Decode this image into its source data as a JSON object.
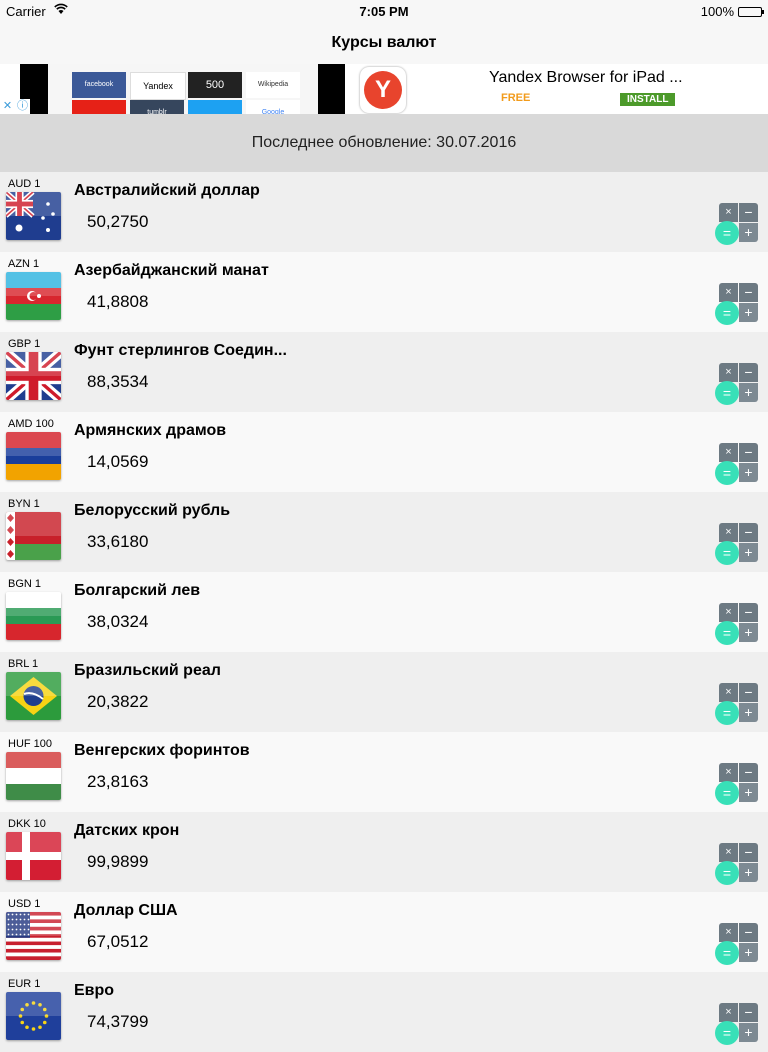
{
  "status": {
    "carrier": "Carrier",
    "time": "7:05 PM",
    "battery": "100%"
  },
  "navbar": {
    "title": "Курсы валют"
  },
  "ad": {
    "title": "Yandex Browser for iPad ...",
    "free": "FREE",
    "install": "INSTALL",
    "logo_letter": "Y",
    "tiles": [
      "facebook",
      "Yandex",
      "500",
      "Wikipedia",
      "",
      "tumblr",
      "",
      "Google"
    ]
  },
  "last_update": "Последнее обновление: 30.07.2016",
  "calculator_keys": {
    "multiply": "×",
    "minus": "−",
    "plus": "+",
    "equals": "="
  },
  "currencies": [
    {
      "code": "AUD 1",
      "name": "Австралийский доллар",
      "rate": "50,2750",
      "flag": "au"
    },
    {
      "code": "AZN 1",
      "name": "Азербайджанский манат",
      "rate": "41,8808",
      "flag": "az"
    },
    {
      "code": "GBP 1",
      "name": "Фунт стерлингов Соедин...",
      "rate": "88,3534",
      "flag": "gb"
    },
    {
      "code": "AMD 100",
      "name": "Армянских драмов",
      "rate": "14,0569",
      "flag": "am"
    },
    {
      "code": "BYN 1",
      "name": "Белорусский рубль",
      "rate": "33,6180",
      "flag": "by"
    },
    {
      "code": "BGN 1",
      "name": "Болгарский лев",
      "rate": "38,0324",
      "flag": "bg"
    },
    {
      "code": "BRL 1",
      "name": "Бразильский реал",
      "rate": "20,3822",
      "flag": "br"
    },
    {
      "code": "HUF 100",
      "name": "Венгерских форинтов",
      "rate": "23,8163",
      "flag": "hu"
    },
    {
      "code": "DKK 10",
      "name": "Датских крон",
      "rate": "99,9899",
      "flag": "dk"
    },
    {
      "code": "USD 1",
      "name": "Доллар США",
      "rate": "67,0512",
      "flag": "us"
    },
    {
      "code": "EUR 1",
      "name": "Евро",
      "rate": "74,3799",
      "flag": "eu"
    }
  ]
}
